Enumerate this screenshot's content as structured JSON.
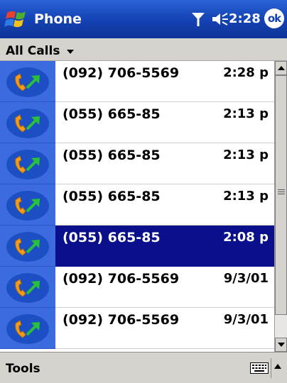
{
  "titlebar": {
    "title": "Phone",
    "clock": "2:28",
    "ok_label": "ok",
    "icons": [
      "windows-start-icon",
      "signal-icon",
      "volume-icon"
    ],
    "colors": {
      "bar": "#1646b8",
      "text": "#ffffff"
    }
  },
  "filter": {
    "label": "All Calls"
  },
  "calls": [
    {
      "number": "(092) 706-5569",
      "time": "2:28 p",
      "selected": false
    },
    {
      "number": "(055) 665-85",
      "time": "2:13 p",
      "selected": false
    },
    {
      "number": "(055) 665-85",
      "time": "2:13 p",
      "selected": false
    },
    {
      "number": "(055) 665-85",
      "time": "2:13 p",
      "selected": false
    },
    {
      "number": "(055) 665-85",
      "time": "2:08 p",
      "selected": true
    },
    {
      "number": "(092) 706-5569",
      "time": "9/3/01",
      "selected": false
    },
    {
      "number": "(092) 706-5569",
      "time": "9/3/01",
      "selected": false
    }
  ],
  "call_icon": "outgoing-call-icon",
  "colors": {
    "icon_cell": "#3b6bde",
    "selected_row": "#0a0f8c"
  },
  "bottombar": {
    "tools_label": "Tools",
    "icons": [
      "keyboard-icon",
      "sip-arrow-icon"
    ]
  }
}
